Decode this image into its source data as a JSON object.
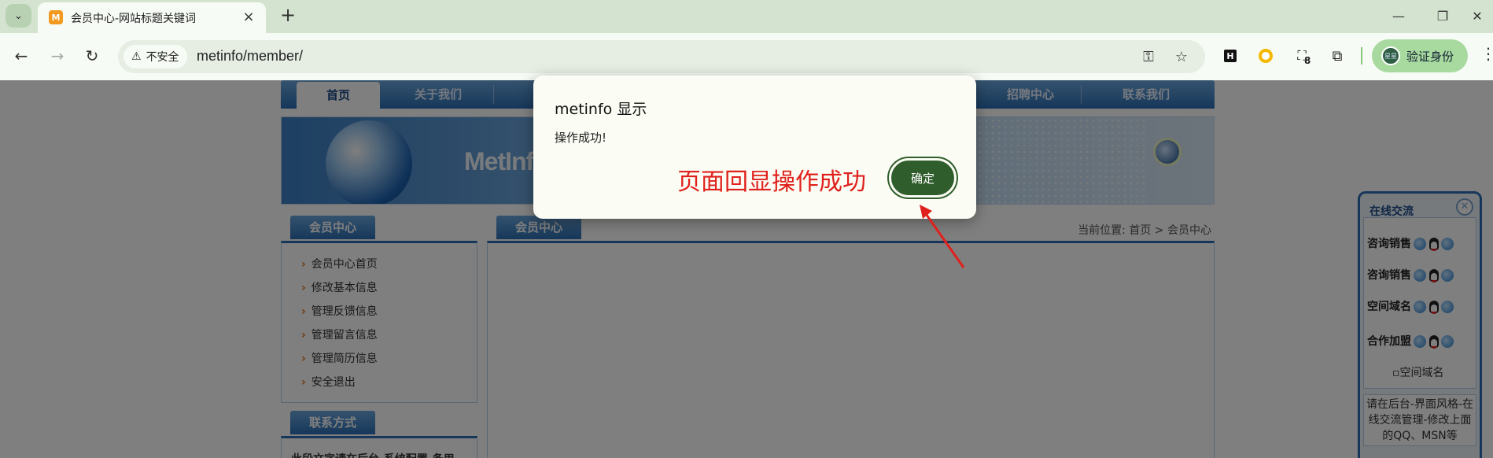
{
  "browser": {
    "tab_title": "会员中心-网站标题关键词",
    "tab_favicon": "M",
    "security_label": "不安全",
    "url": "metinfo/member/",
    "extension_badge": "8",
    "profile_label": "验证身份",
    "profile_avatar_text": "星星"
  },
  "site": {
    "nav": [
      "首页",
      "关于我们",
      "",
      "",
      "",
      "",
      "招聘中心",
      "联系我们"
    ],
    "banner_text": "MetInfo",
    "member_center_tab": "会员中心",
    "main_tab": "会员中心",
    "breadcrumb": "当前位置: 首页 > 会员中心",
    "side_links": [
      "会员中心首页",
      "修改基本信息",
      "管理反馈信息",
      "管理留言信息",
      "管理简历信息",
      "安全退出"
    ],
    "contact_tab": "联系方式",
    "contact_text": "此段文字请在后台-系统配置-备用"
  },
  "online": {
    "title": "在线交流",
    "rows": [
      "咨询销售",
      "咨询销售",
      "空间域名",
      "合作加盟"
    ],
    "img_alt": "空间域名",
    "note": "请在后台-界面风格-在线交流管理-修改上面的QQ、MSN等"
  },
  "dialog": {
    "title": "metinfo 显示",
    "message": "操作成功!",
    "ok_label": "确定"
  },
  "annotation": "页面回显操作成功",
  "colors": {
    "annotation": "#e0201c",
    "ok_button": "#2f5d2c",
    "site_blue": "#2d6fb5"
  }
}
